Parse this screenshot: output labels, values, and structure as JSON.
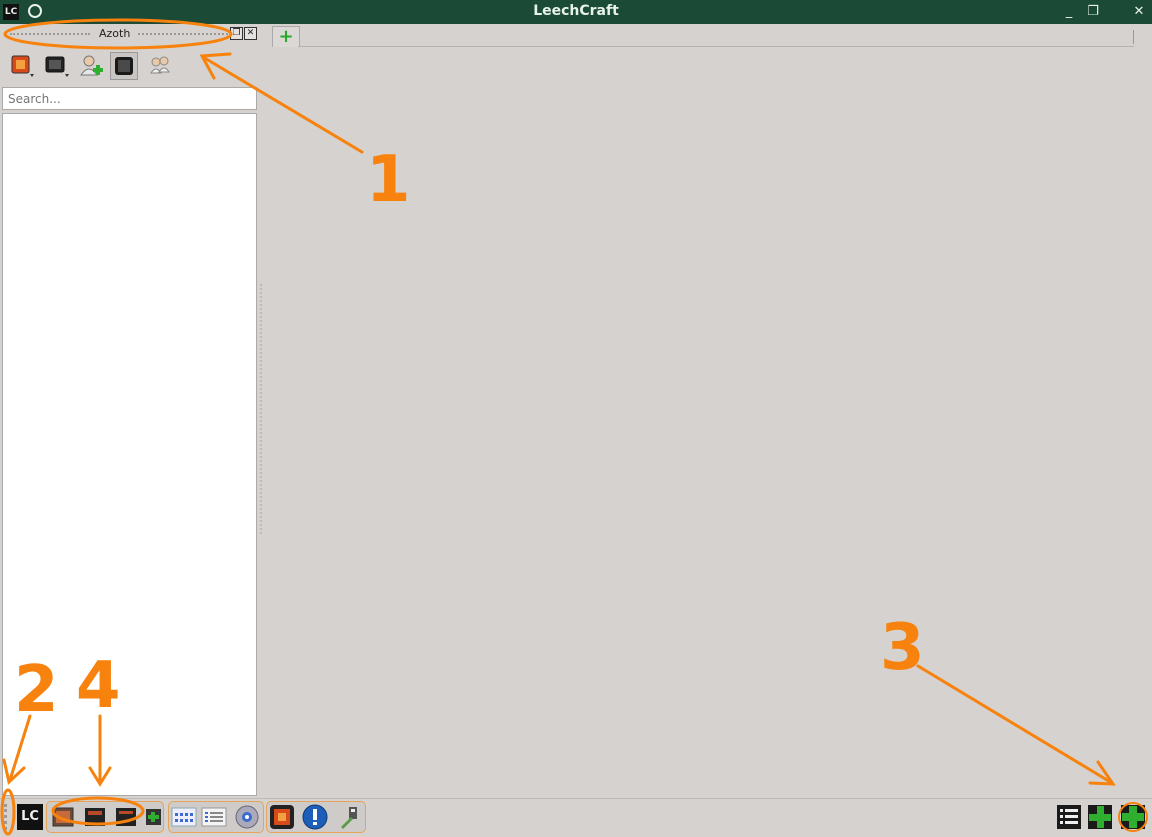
{
  "window": {
    "title": "LeechCraft",
    "logo_text": "LC",
    "controls": {
      "minimize": "_",
      "restore": "❐",
      "close": "✕"
    }
  },
  "dock": {
    "title": "Azoth",
    "float_label": "❐",
    "close_label": "✕"
  },
  "tabs": {
    "add_tab_label": "+"
  },
  "toolbar": {
    "buttons": [
      {
        "icon": "status-menu-icon"
      },
      {
        "icon": "console-menu-icon"
      },
      {
        "icon": "add-contact-icon"
      },
      {
        "icon": "toggle-view-icon"
      },
      {
        "icon": "account-icon"
      }
    ]
  },
  "search": {
    "placeholder": "Search..."
  },
  "bottombar": {
    "lc_logo_text": "LC"
  },
  "annotations": {
    "one": "1",
    "two": "2",
    "three": "3",
    "four": "4"
  },
  "colors": {
    "titlebar": "#1b4a36",
    "accent": "#f7820d",
    "background": "#d6d2cf"
  }
}
